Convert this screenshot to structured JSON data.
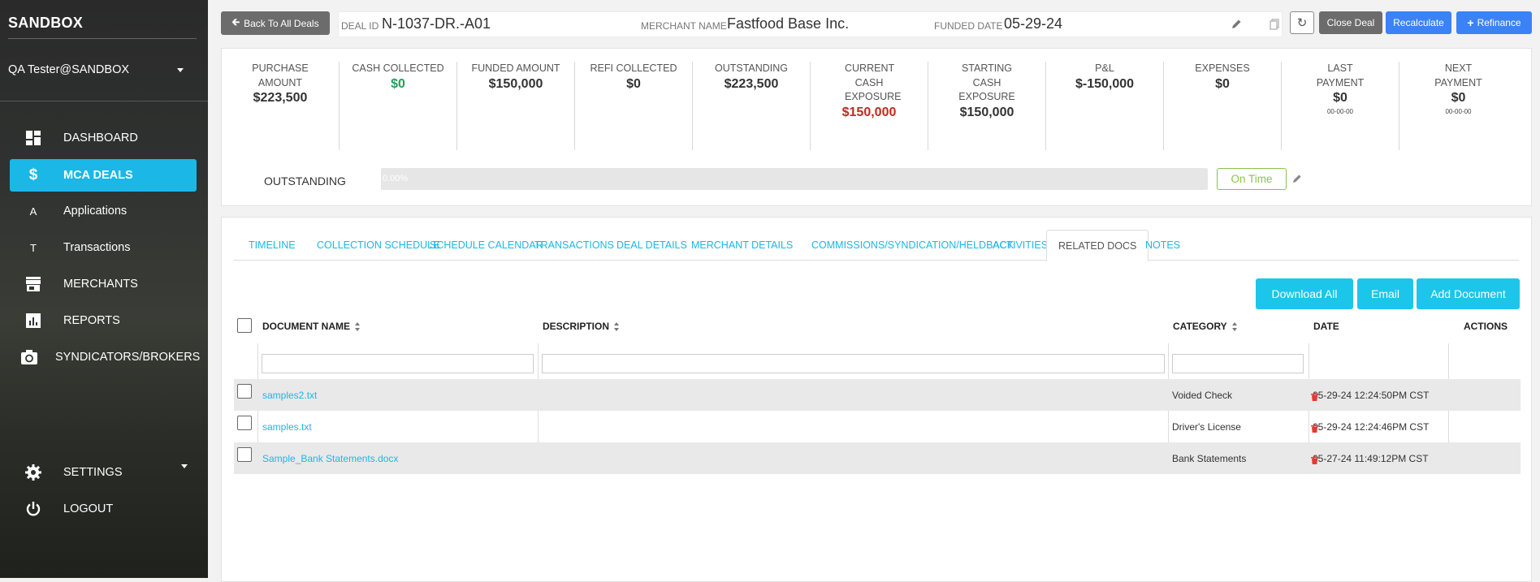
{
  "sidebar": {
    "brand": "SANDBOX",
    "user": "QA Tester@SANDBOX",
    "items": [
      {
        "label": "DASHBOARD",
        "icon": "dashboard-icon"
      },
      {
        "label": "MCA DEALS",
        "icon": "dollar-icon",
        "active": true
      },
      {
        "label": "Applications",
        "icon": "A"
      },
      {
        "label": "Transactions",
        "icon": "T"
      },
      {
        "label": "MERCHANTS",
        "icon": "store-icon"
      },
      {
        "label": "REPORTS",
        "icon": "bar-chart-icon"
      },
      {
        "label": "SYNDICATORS/BROKERS",
        "icon": "camera-rotate-icon"
      },
      {
        "label": "SETTINGS",
        "icon": "gear-icon"
      },
      {
        "label": "LOGOUT",
        "icon": "power-icon"
      }
    ]
  },
  "topbar": {
    "back_label": "Back To All Deals",
    "deal_id_label": "DEAL ID",
    "deal_id": "N-1037-DR.-A01",
    "merchant_label": "MERCHANT NAME",
    "merchant": "Fastfood Base Inc.",
    "funded_date_label": "FUNDED DATE",
    "funded_date": "05-29-24",
    "close_label": "Close Deal",
    "recalc_label": "Recalculate",
    "refinance_label": "Refinance"
  },
  "stats": [
    {
      "label": "PURCHASE AMOUNT",
      "value": "$223,500"
    },
    {
      "label": "CASH COLLECTED",
      "value": "$0",
      "color": "#22a05a"
    },
    {
      "label": "FUNDED AMOUNT",
      "value": "$150,000"
    },
    {
      "label": "REFI COLLECTED",
      "value": "$0"
    },
    {
      "label": "OUTSTANDING",
      "value": "$223,500"
    },
    {
      "label": "CURRENT CASH EXPOSURE",
      "value": "$150,000",
      "color": "#c0291e"
    },
    {
      "label": "STARTING CASH EXPOSURE",
      "value": "$150,000"
    },
    {
      "label": "P&L",
      "value": "$-150,000"
    },
    {
      "label": "EXPENSES",
      "value": "$0"
    },
    {
      "label": "LAST PAYMENT",
      "value": "$0",
      "date": "00-00-00"
    },
    {
      "label": "NEXT PAYMENT",
      "value": "$0",
      "date": "00-00-00"
    }
  ],
  "outstanding": {
    "label": "OUTSTANDING",
    "percent_text": "0.00%",
    "fraction": 0.0,
    "status": "On Time"
  },
  "tabs": [
    "TIMELINE",
    "COLLECTION SCHEDULE",
    "SCHEDULE CALENDAR",
    "TRANSACTIONS",
    "DEAL DETAILS",
    "MERCHANT DETAILS",
    "COMMISSIONS/SYNDICATION/HELDBACK",
    "ACTIVITIES",
    "RELATED DOCS",
    "NOTES"
  ],
  "active_tab": "RELATED DOCS",
  "doc_actions": {
    "download_all": "Download All",
    "email": "Email",
    "add_document": "Add Document"
  },
  "table": {
    "headers": {
      "name": "DOCUMENT NAME",
      "description": "DESCRIPTION",
      "category": "CATEGORY",
      "date": "DATE",
      "actions": "ACTIONS"
    },
    "rows": [
      {
        "name": "samples2.txt",
        "description": "",
        "category": "Voided Check",
        "date": "05-29-24 12:24:50PM CST"
      },
      {
        "name": "samples.txt",
        "description": "",
        "category": "Driver's License",
        "date": "05-29-24 12:24:46PM CST"
      },
      {
        "name": "Sample_Bank Statements.docx",
        "description": "",
        "category": "Bank Statements",
        "date": "05-27-24 11:49:12PM CST"
      }
    ]
  },
  "colors": {
    "accent": "#1bb7e6",
    "primary_button": "#3b82f6",
    "secondary_button": "#6c6c6c",
    "ontime": "#8bc34a",
    "danger": "#e53935"
  }
}
